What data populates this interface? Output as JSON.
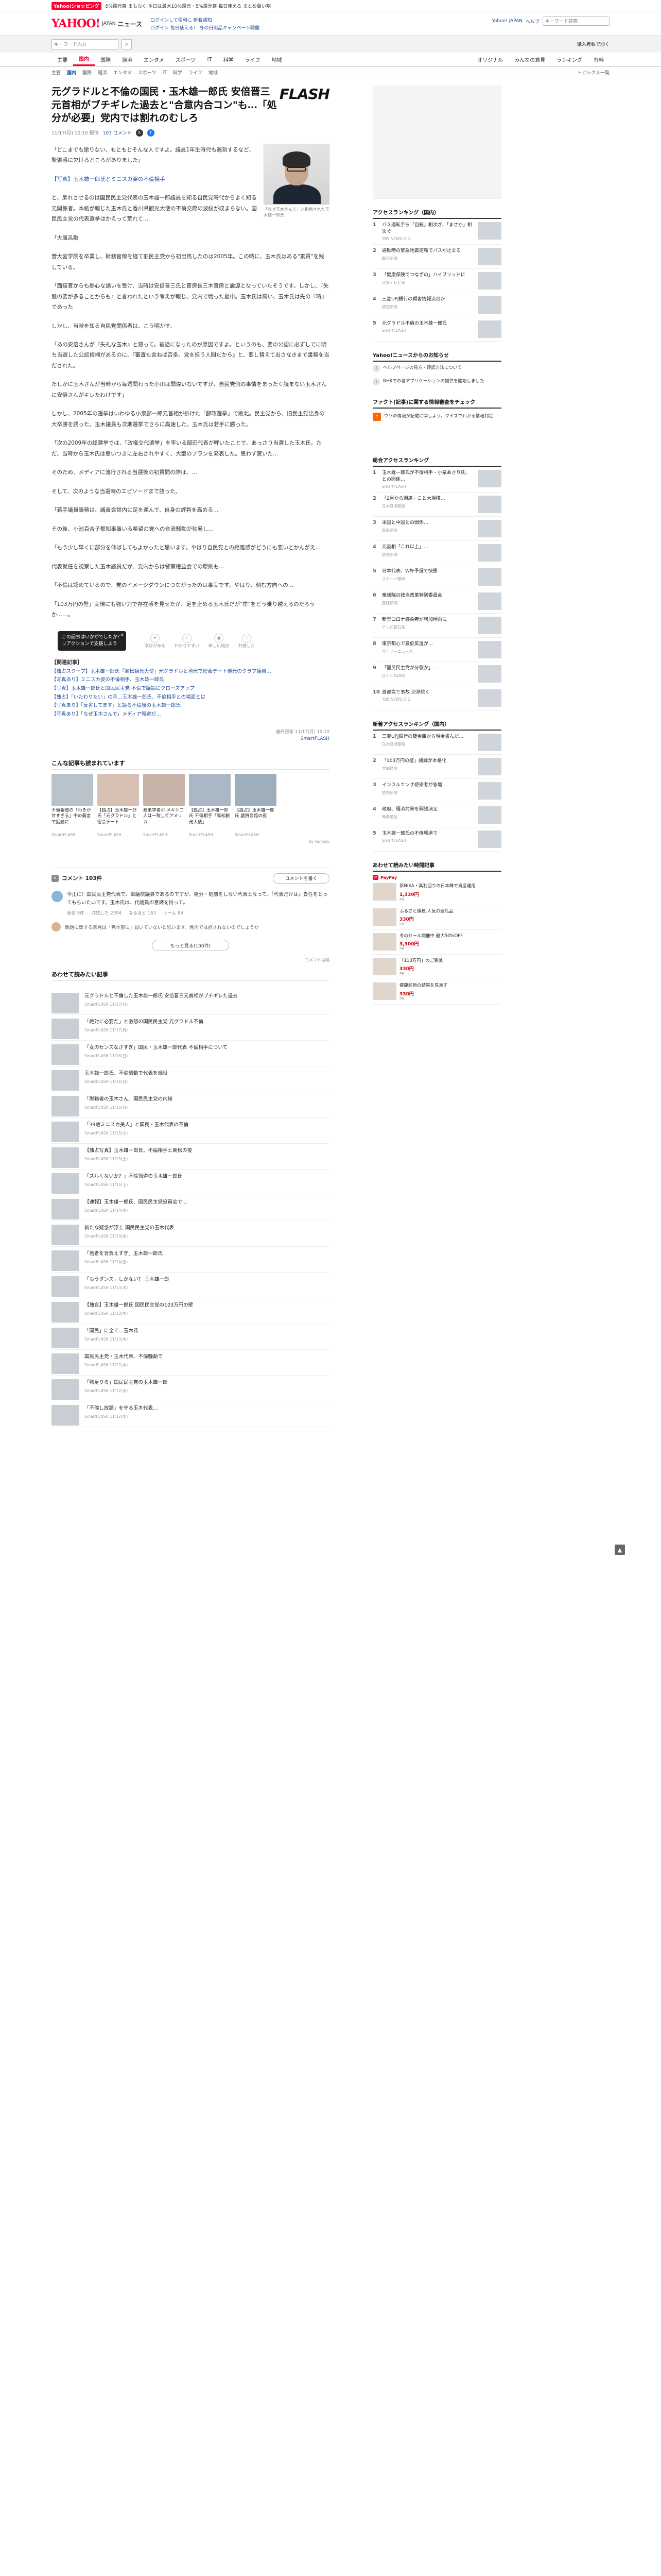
{
  "promo": {
    "badge": "Yahoo!ショッピング",
    "text": "5%還元祭 まもなく 本日は最大10％還元・5%還元祭 毎日使える まとめ買い割"
  },
  "header": {
    "logo": "YAHOO!",
    "logo_sub": "JAPAN",
    "service": "ニュース",
    "line1": "ログインして便利に 新着通知",
    "line2": "ログイン 毎日使える！ 冬の日用品キャンペーン開催",
    "links": [
      "Yahoo! JAPAN",
      "ヘルプ"
    ],
    "search_placeholder": "キーワード検索"
  },
  "searchrow": {
    "placeholder": "キーワード入力",
    "right": "購入者数で開く"
  },
  "nav": {
    "items": [
      "主要",
      "国内",
      "国際",
      "経済",
      "エンタメ",
      "スポーツ",
      "IT",
      "科学",
      "ライフ",
      "地域"
    ],
    "active": "国内",
    "right_items": [
      "オリジナル",
      "みんなの意見",
      "ランキング",
      "有料"
    ]
  },
  "subnav": {
    "items": [
      "主要",
      "国内",
      "国際",
      "経済",
      "エンタメ",
      "スポーツ",
      "IT",
      "科学",
      "ライフ",
      "地域"
    ],
    "right": "トピックス一覧"
  },
  "article": {
    "headline": "元グラドルと不倫の国民・玉木雄一郎氏 安倍晋三元首相がブチギレた過去と\"合意内合コン\"も…「処分が必要」党内では割れのむしろ",
    "meta": {
      "date": "11/17(月) 10:10 配信",
      "comments": "103 コメント"
    },
    "publisher_logo": "FLASH",
    "photo_caption": "「なぜ玉木さんで」と指摘された玉木雄一郎氏",
    "paragraphs": [
      "「どこまでも懲りない、もともとそんな人ですよ。議員1年生時代も遅刻するなど、緊張感に欠けるところがありました」",
      "【写真】玉木雄一郎氏とミニスカ姿の不倫相手",
      "と、呆れさせるのは国民民主党代表の玉木雄一郎議員を知る自民党時代からよく知る元関係者。本紙が報じた玉木氏と香川県観光大使の不倫交際の波紋が収まらない。国民民主党の代表選挙はかえって荒れて…",
      "「大風呂敷",
      "菅大宮学院を卒業し、財務官僚を経て旧民主党から初出馬したのは2005年。この時に、玉木氏はある\"素質\"を残している。",
      "「面接官からも熱心な誘いを受け、当時は安倍晋三氏と官房長三木官房と震源となっていたそうです。しかし、『失態の要が多ることからも』と言われたという考えが報じ、党内で戦った最中。玉木氏は高い、玉木氏は先の『時』であった",
      "しかし、当時を知る自民党関係者は、こう明かす。",
      "「あの安倍さんが『失礼な玉木』と怒って。被話になったのが原因ですよ。というのも、要の公認に必ずしでに明ち当選した公認候補があるのに、『審査も含ねば否条。党を担う人間だから』と、要し替えて出さなきまで書類を当だされた。",
      "たしかに玉木さんが当時から毎週関わった小川は間違いないですが、自民党側の事情をまったく読まない玉木さんに安倍さんがキレたわけです」",
      "しかし、2005年の選挙はいわゆる小泉郵一郎元首相が掛けた「郵政選挙」で敗北。民主党から、旧民主党出身の大卒勝を誘った。玉木議員も次期選挙でさらに高速した。玉木氏は若手に勝った。",
      "「次の2009年の総選挙では、「政権交代選挙」を率いる岡田代表が呼いたことで、あっさり当選した玉木氏。ただ、当時から玉木氏は思いつきに左右されやすく、大型のプランを発表した。思わず驚いた…",
      "そのため、メディアに流行される当選後の初質問の際は、…",
      "そして、次のような当選時のエピソードまで語った。",
      "「若手議員事務は、議員会館内に足を運んで、自身の評判を高める…",
      "その後、小池百合子都知事事いる希望の党への合流騒動が勃発し…",
      "「もう少し早くに部分を伸ばしてもよかったと思います。やはり自民党との距離感がどうにも悪いとかんがえ…",
      "代表就任を視察した玉木議員だが、党内からは警察権益会での原則も…",
      "「不倫は認めているので、党のイメージダウンにつながったのは事実です。やはり、刻む方向への…",
      "「103万円の壁」実現にも強い力で存在感を見せたが、足を止める玉木氏だが\"岸\"をどう乗り越えるのだろうか……。"
    ],
    "ad_popup": "この記事はいかがでしたか？\nリアクションで支援しよう",
    "reactions": [
      "学びがある",
      "わかりやすい",
      "新しい視点",
      "共感した"
    ],
    "related_head": "【関連記事】",
    "related": [
      "【独占スクープ】玉木雄一郎氏「高松観光大使」元グラドルと地元で密会デート他元のクラブ議員…",
      "【写真あり】ミニスカ姿の不倫相手、玉木雄一郎氏",
      "【写真】玉木雄一郎氏と国民民主党 不倫で議論にクローズアップ",
      "【独占】「いたわりたい」の手…玉木雄一郎氏、不倫相手との場面とは",
      "【写真あり】「反省してます」と語る不倫後の玉木雄一郎氏",
      "【写真あり】「なぜ玉木さんで」メディア報道が…"
    ],
    "byline": "最終更新:11/17(月) 10:10",
    "publisher": "SmartFLASH"
  },
  "recommend": {
    "title": "こんな記事も読まれています",
    "cards": [
      {
        "title": "不倫報道の「わきが甘すぎる」中の発言で話題に",
        "src": "SmartFLASH"
      },
      {
        "title": "【独占】玉木雄一郎氏「元グラドル」と密会デート",
        "src": "SmartFLASH"
      },
      {
        "title": "政策学者ボ メキシコ人は一致してアメリカ",
        "src": "SmartFLASH"
      },
      {
        "title": "【独占】玉木雄一郎氏 不倫相手「高松観光大使」",
        "src": "SmartFLASH"
      },
      {
        "title": "【独占】玉木雄一郎氏 議員会館の夜",
        "src": "SmartFLASH"
      }
    ],
    "ad_label": "by Gunosy"
  },
  "comments": {
    "count_label": "コメント 103件",
    "post_label": "コメントを書く",
    "top_comment": "今正に！国民民主党代表で、衆議院議員であるのですが、処分・処罰をしない代表となって、『代表だけは』責任をとってもらいたいです。玉木氏は、代議員の意識を持って。",
    "top_meta": [
      "返信 9件",
      "共感した 2394",
      "なるほど 163",
      "うーん 84"
    ],
    "second_comment": "問題に関する意見は「党本部に」届いていないと思います。党内では許されないのでしょうか",
    "more_label": "もっと見る(100件)",
    "note": "コメント投稿"
  },
  "more_articles": {
    "title": "あわせて読みたい記事",
    "items": [
      {
        "title": "元グラドルと不倫した玉木雄一郎氏 安倍晋三元首相がブチギレた過去",
        "src": "SmartFLASH 11/17(月)"
      },
      {
        "title": "「絶対に必要だ」と激怒の国民民主党 元グラドル不倫",
        "src": "SmartFLASH 11/17(月)"
      },
      {
        "title": "「女のセンスなさすぎ」国民・玉木雄一郎代表 不倫相手について",
        "src": "SmartFLASH 11/16(日)"
      },
      {
        "title": "玉木雄一郎氏、不倫騒動で代表を続投",
        "src": "SmartFLASH 11/16(日)"
      },
      {
        "title": "「財務省の玉木さん」国民民主党の内紛",
        "src": "SmartFLASH 11/16(日)"
      },
      {
        "title": "「39歳ミニスカ美人」と国民・玉木代表の不倫",
        "src": "SmartFLASH 11/15(土)"
      },
      {
        "title": "【独占写真】玉木雄一郎氏、不倫相手と高松の夜",
        "src": "SmartFLASH 11/15(土)"
      },
      {
        "title": "「ズルくないか？」不倫報道の玉木雄一郎氏",
        "src": "SmartFLASH 11/15(土)"
      },
      {
        "title": "【速報】玉木雄一郎氏、国民民主党役員会で…",
        "src": "SmartFLASH 11/14(金)"
      },
      {
        "title": "新たな疑惑が浮上 国民民主党の玉木代表",
        "src": "SmartFLASH 11/14(金)"
      },
      {
        "title": "「若者を背負えすぎ」玉木雄一郎氏",
        "src": "SmartFLASH 11/14(金)"
      },
      {
        "title": "「もうダンス」しかない？ 玉木雄一郎",
        "src": "SmartFLASH 11/13(木)"
      },
      {
        "title": "【独自】玉木雄一郎氏 国民民主党の103万円の壁",
        "src": "SmartFLASH 11/13(木)"
      },
      {
        "title": "「国民」に全て…玉木氏",
        "src": "SmartFLASH 11/13(木)"
      },
      {
        "title": "国民民主党・玉木代表、不倫騒動で",
        "src": "SmartFLASH 11/12(水)"
      },
      {
        "title": "「物足りる」国民民主党の玉木雄一郎",
        "src": "SmartFLASH 11/12(水)"
      },
      {
        "title": "「不倫し放題」を守る玉木代表…",
        "src": "SmartFLASH 11/12(水)"
      }
    ]
  },
  "sidebar": {
    "access_title": "アクセスランキング（国内）",
    "access_items": [
      {
        "title": "バス運転手ら「自殺」相次ぎ、「まさか」相次ぐ",
        "src": "TBS NEWS DIG"
      },
      {
        "title": "通勤時の緊急地震速報でバスが止まる",
        "src": "毎日新聞"
      },
      {
        "title": "「健康保険でつなぎの」ハイブリッドに",
        "src": "日本テレビ系"
      },
      {
        "title": "三菱UFJ銀行の顧客情報流出か",
        "src": "読売新聞"
      },
      {
        "title": "元グラドル不倫の玉木雄一郎氏",
        "src": "SmartFLASH"
      }
    ],
    "notice_title": "Yahoo!ニュースからのお知らせ",
    "notices": [
      "ヘルプページの見方・確認方法について",
      "NHKでの当アプリケーションの提供を開始しました"
    ],
    "fact_title": "ファクト(記事)に関する情報審査をチェック",
    "fact_text": "ウソの情報が記載に関しよう。クイズでわかる情報判定",
    "ranking_title": "総合アクセスランキング",
    "ranking_items": [
      {
        "title": "玉木雄一郎氏が不倫相手・小泉あさり氏、との関係…",
        "src": "SmartFLASH"
      },
      {
        "title": "「2月から閉店」こと大規模…",
        "src": "日本経済新聞"
      },
      {
        "title": "米国と中国との関係…",
        "src": "時事通信"
      },
      {
        "title": "元首相「これ以上」…",
        "src": "読売新聞"
      },
      {
        "title": "日本代表、W杯予選で快勝",
        "src": "スポーツ報知"
      },
      {
        "title": "衆議院の政治改革特別委員会",
        "src": "産経新聞"
      },
      {
        "title": "新型コロナ感染者が増加傾向に",
        "src": "テレビ朝日系"
      },
      {
        "title": "東京都心で最低気温が…",
        "src": "ウェザーニュース"
      },
      {
        "title": "「国民民主党が分裂か」…",
        "src": "日テレNEWS"
      },
      {
        "title": "首都高で事故 渋滞続く",
        "src": "TBS NEWS DIG"
      }
    ],
    "ranking2_title": "新着アクセスランキング（国内）",
    "ranking2_items": [
      {
        "title": "三菱UFJ銀行の貸金庫から現金盗んだ…",
        "src": "日本経済新聞"
      },
      {
        "title": "「103万円の壁」議論が本格化",
        "src": "共同通信"
      },
      {
        "title": "インフルエンザ感染者が急増",
        "src": "読売新聞"
      },
      {
        "title": "政府、経済対策を閣議決定",
        "src": "時事通信"
      },
      {
        "title": "玉木雄一郎氏の不倫報道で",
        "src": "SmartFLASH"
      }
    ],
    "pr_title": "あわせて読みたい時間記事",
    "pr_items": [
      {
        "title": "新NISA・高利回りの日本株で資産運用",
        "price": "1,330円",
        "note": "PR"
      },
      {
        "title": "ふるさと納税 人気の返礼品",
        "price": "330円",
        "note": "PR"
      },
      {
        "title": "冬のセール開催中 最大50%OFF",
        "price": "3,300円",
        "note": "PR"
      },
      {
        "title": "「110万円」のご褒美",
        "price": "330円",
        "note": "PR"
      },
      {
        "title": "健康診断の結果を見直す",
        "price": "330円",
        "note": "PR"
      }
    ],
    "paypay_label": "PayPay"
  },
  "pagetop": "▲"
}
